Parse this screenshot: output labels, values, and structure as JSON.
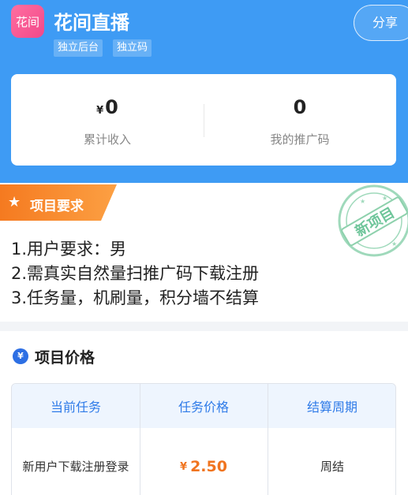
{
  "header": {
    "logo_text": "花间",
    "title": "花间直播",
    "tags": [
      "独立后台",
      "独立码"
    ],
    "share_label": "分享"
  },
  "stats": {
    "income_currency": "¥",
    "income_value": "0",
    "income_label": "累计收入",
    "codes_value": "0",
    "codes_label": "我的推广码"
  },
  "requirements": {
    "title": "项目要求",
    "stamp_text": "新项目",
    "lines": [
      "1.用户要求：男",
      "2.需真实自然量扫推广码下载注册",
      "3.任务量，机刷量，积分墙不结算"
    ]
  },
  "pricing": {
    "icon_text": "¥",
    "title": "项目价格",
    "columns": [
      "当前任务",
      "任务价格",
      "结算周期"
    ],
    "row": {
      "task": "新用户下载注册登录",
      "currency": "¥",
      "price": "2.50",
      "cycle": "周结"
    }
  },
  "colors": {
    "header_blue": "#3e9bf4",
    "accent_orange": "#f0741f",
    "table_header_text": "#2f7be8",
    "stamp_green": "#7cc9a3"
  }
}
